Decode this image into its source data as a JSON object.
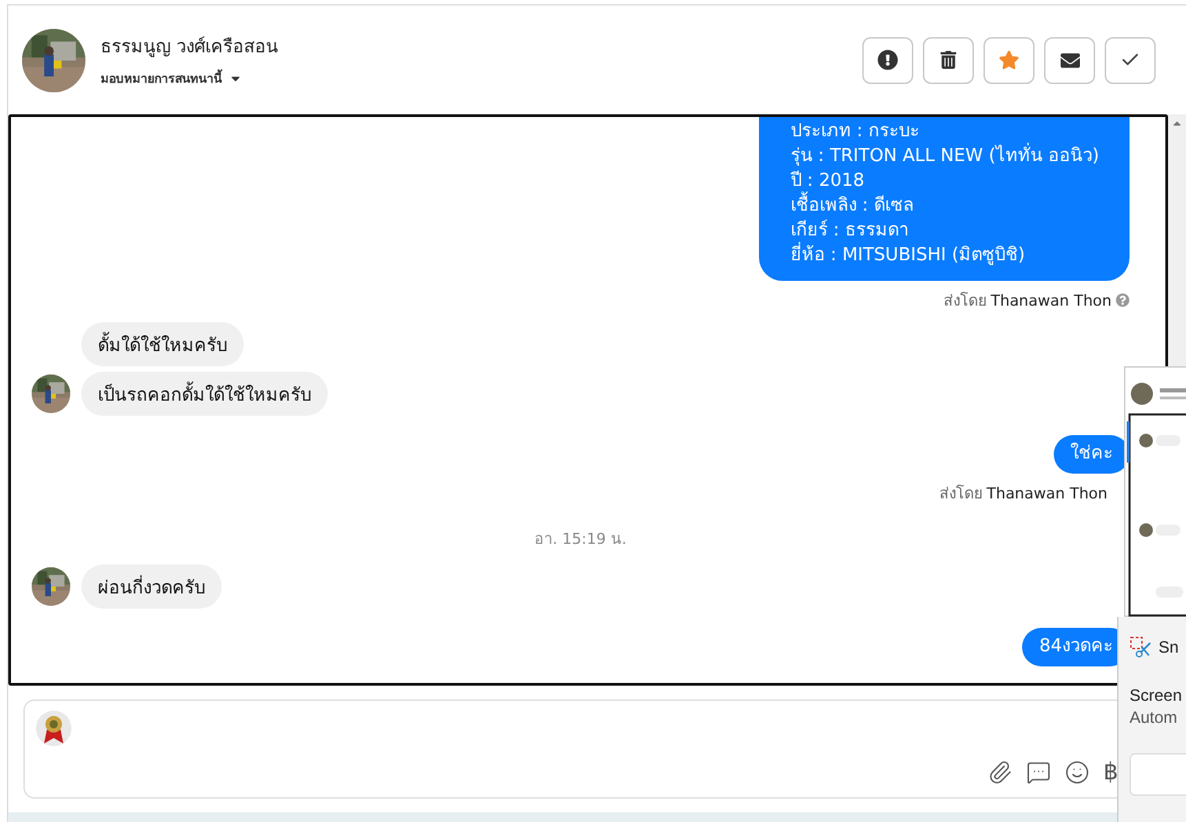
{
  "contact": {
    "name": "ธรรมนูญ วงศ์เครือสอน",
    "assign": "มอบหมายการสนทนานี้"
  },
  "actions": [
    {
      "kind": "report"
    },
    {
      "kind": "delete"
    },
    {
      "kind": "star"
    },
    {
      "kind": "mail"
    },
    {
      "kind": "done"
    }
  ],
  "messages": [
    {
      "kind": "out",
      "lines": [
        "ประเภท : กระบะ",
        "รุ่น : TRITON ALL NEW (ไททั่น ออนิว)",
        "ปี : 2018",
        "เชื้อเพลิง : ดีเซล",
        "เกียร์ : ธรรมดา",
        "ยี่ห้อ : MITSUBISHI (มิตซูบิชิ)"
      ]
    },
    {
      "kind": "sent_by",
      "prefix": "ส่งโดย",
      "name": "Thanawan Thon",
      "info": true
    },
    {
      "kind": "in",
      "text": "ดั้มใด้ใช้ใหมครับ",
      "avatar": false
    },
    {
      "kind": "in",
      "text": "เป็นรถคอกดั้มใด้ใช้ใหมครับ",
      "avatar": true
    },
    {
      "kind": "out",
      "lines": [
        "ใช่คะ"
      ]
    },
    {
      "kind": "sent_by",
      "prefix": "ส่งโดย",
      "name": "Thanawan Thon",
      "info": false
    },
    {
      "kind": "time",
      "text": "อา. 15:19 น."
    },
    {
      "kind": "in",
      "text": "ผ่อนกี่งวดครับ",
      "avatar": true
    },
    {
      "kind": "out",
      "lines": [
        "84งวดคะ"
      ]
    }
  ],
  "composer_tools": [
    {
      "kind": "attach"
    },
    {
      "kind": "comment"
    },
    {
      "kind": "emoji"
    },
    {
      "kind": "currency",
      "glyph": "฿"
    }
  ],
  "notification": {
    "app": "Sn",
    "title": "Screen",
    "body": "Autom"
  }
}
